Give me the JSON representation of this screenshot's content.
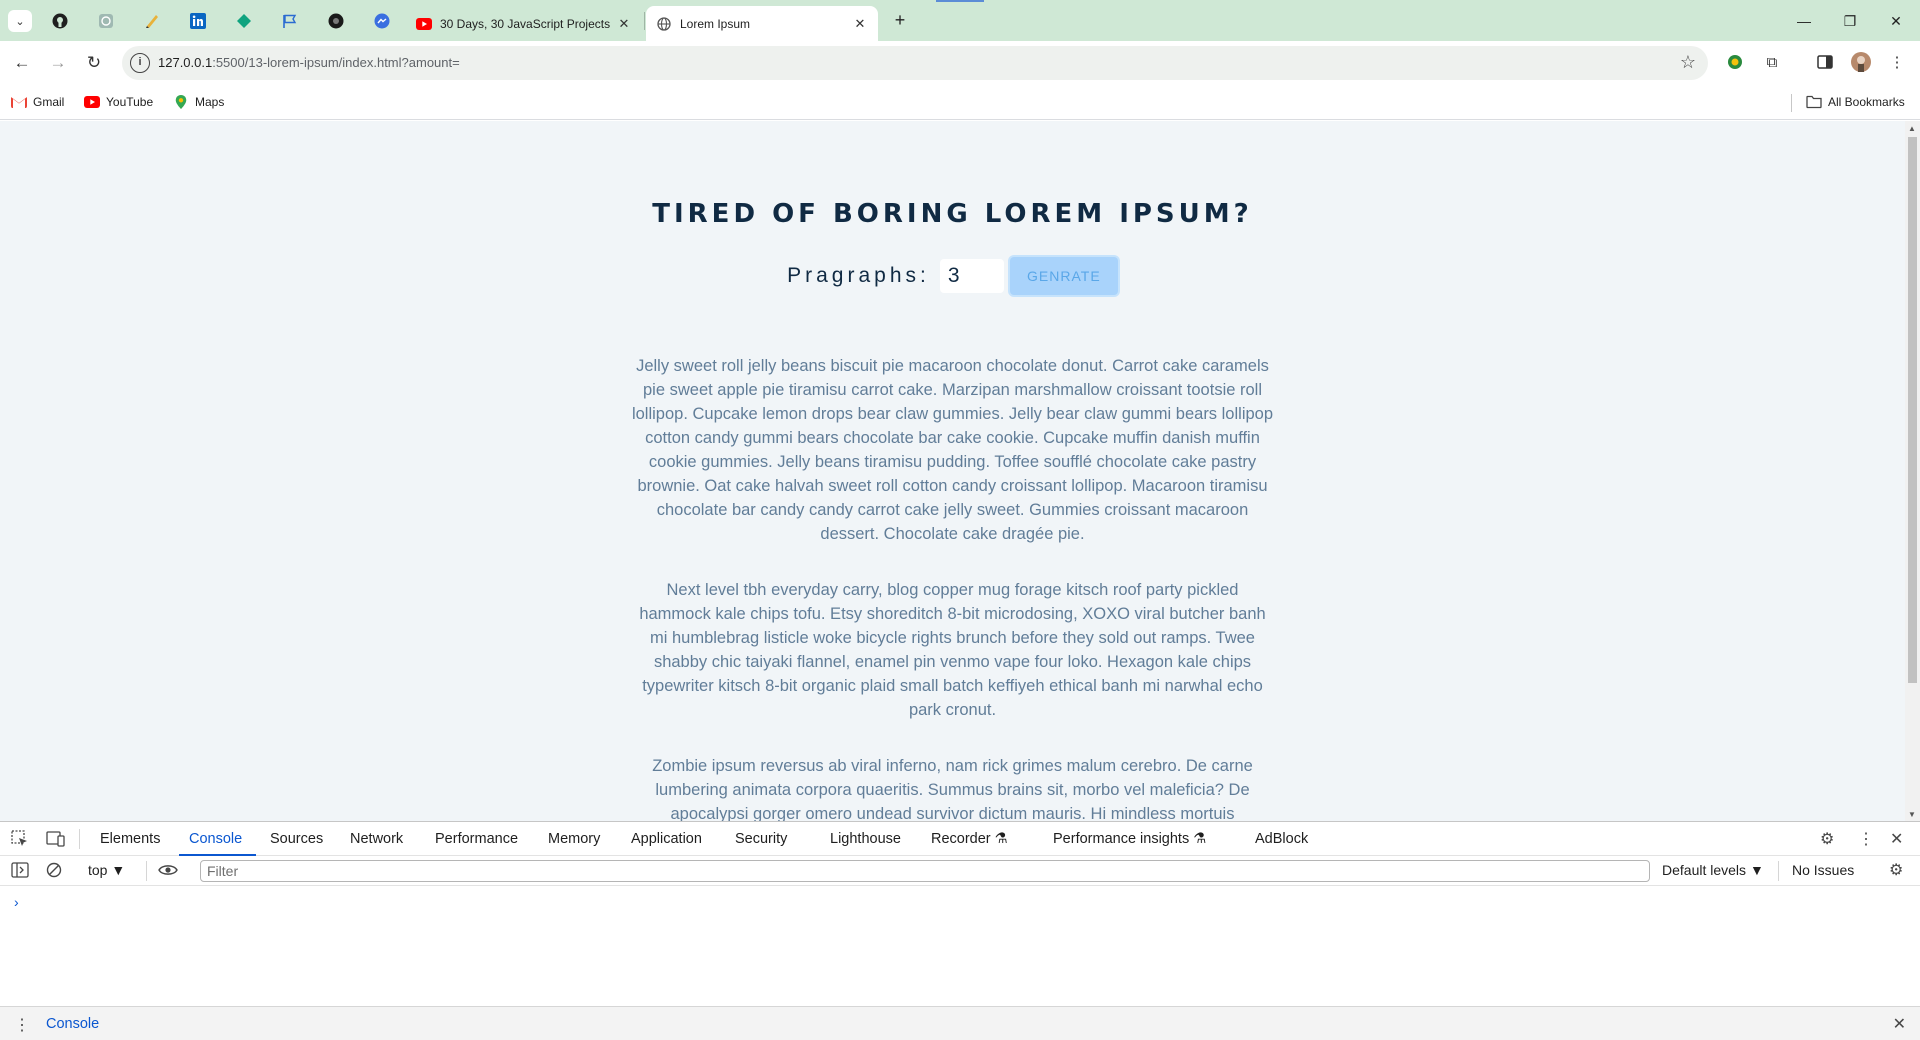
{
  "browser": {
    "tabs": [
      {
        "title": "30 Days, 30 JavaScript Projects",
        "icon": "youtube-icon"
      },
      {
        "title": "Lorem Ipsum",
        "icon": "globe-icon",
        "active": true
      }
    ],
    "pinned_tabs": [
      "github-icon",
      "chatgpt-icon",
      "draw-icon",
      "linkedin-icon",
      "diamond-icon",
      "flag-icon",
      "circle-icon",
      "messenger-icon"
    ],
    "url_host": "127.0.0.1",
    "url_rest": ":5500/13-lorem-ipsum/index.html?amount=",
    "bookmarks": [
      {
        "label": "Gmail",
        "icon": "gmail-icon"
      },
      {
        "label": "YouTube",
        "icon": "youtube-icon"
      },
      {
        "label": "Maps",
        "icon": "maps-icon"
      }
    ],
    "all_bookmarks_label": "All Bookmarks",
    "accent_color": "#cfe8d5"
  },
  "page": {
    "title": "TIRED OF BORING LOREM IPSUM?",
    "form_label": "Pragraphs:",
    "amount_value": "3",
    "button_label": "GENRATE",
    "paragraphs": [
      "Jelly sweet roll jelly beans biscuit pie macaroon chocolate donut. Carrot cake caramels pie sweet apple pie tiramisu carrot cake. Marzipan marshmallow croissant tootsie roll lollipop. Cupcake lemon drops bear claw gummies. Jelly bear claw gummi bears lollipop cotton candy gummi bears chocolate bar cake cookie. Cupcake muffin danish muffin cookie gummies. Jelly beans tiramisu pudding. Toffee soufflé chocolate cake pastry brownie. Oat cake halvah sweet roll cotton candy croissant lollipop. Macaroon tiramisu chocolate bar candy candy carrot cake jelly sweet. Gummies croissant macaroon dessert. Chocolate cake dragée pie.",
      "Next level tbh everyday carry, blog copper mug forage kitsch roof party pickled hammock kale chips tofu. Etsy shoreditch 8-bit microdosing, XOXO viral butcher banh mi humblebrag listicle woke bicycle rights brunch before they sold out ramps. Twee shabby chic taiyaki flannel, enamel pin venmo vape four loko. Hexagon kale chips typewriter kitsch 8-bit organic plaid small batch keffiyeh ethical banh mi narwhal echo park cronut.",
      "Zombie ipsum reversus ab viral inferno, nam rick grimes malum cerebro. De carne lumbering animata corpora quaeritis. Summus brains sit, morbo vel maleficia? De apocalypsi gorger omero undead survivor dictum mauris. Hi mindless mortuis"
    ],
    "colors": {
      "background": "#f1f5f8",
      "title": "#102a43",
      "text": "#617d98",
      "button": "#a9d3fb"
    }
  },
  "devtools": {
    "tabs": [
      "Elements",
      "Console",
      "Sources",
      "Network",
      "Performance",
      "Memory",
      "Application",
      "Security",
      "Lighthouse",
      "Recorder",
      "Performance insights",
      "AdBlock"
    ],
    "active_tab": "Console",
    "context": "top",
    "filter_placeholder": "Filter",
    "levels": "Default levels",
    "issues": "No Issues",
    "prompt": "›",
    "drawer_tab": "Console"
  }
}
